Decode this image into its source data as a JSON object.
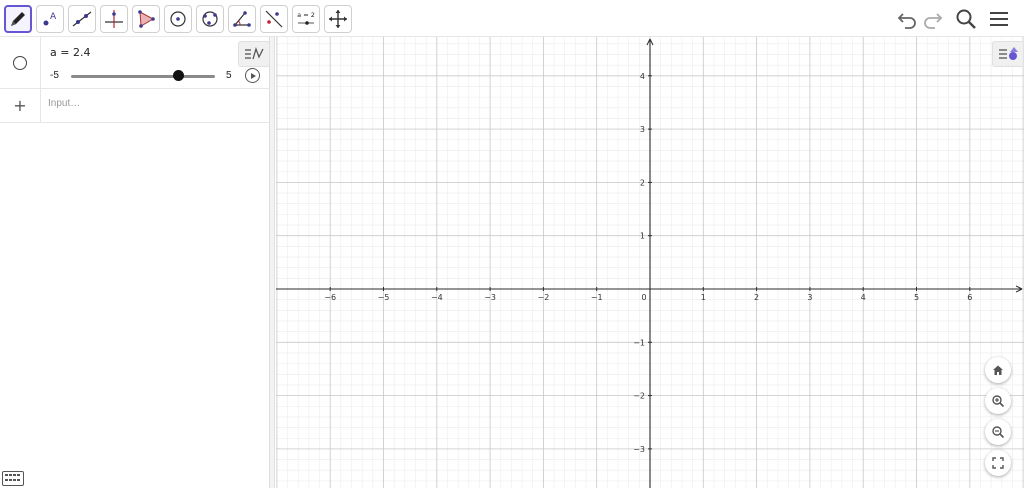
{
  "toolbar": {
    "tools": [
      {
        "name": "move-tool",
        "active": true
      },
      {
        "name": "point-tool"
      },
      {
        "name": "line-tool"
      },
      {
        "name": "perpendicular-line-tool"
      },
      {
        "name": "polygon-tool"
      },
      {
        "name": "circle-with-center-tool"
      },
      {
        "name": "circle-through-points-tool"
      },
      {
        "name": "angle-tool"
      },
      {
        "name": "reflect-tool"
      },
      {
        "name": "slider-tool",
        "label": "a = 2"
      },
      {
        "name": "move-graphics-view-tool"
      }
    ],
    "actions": [
      "undo-icon",
      "redo-icon",
      "search-icon",
      "menu-icon"
    ]
  },
  "algebra": {
    "slider": {
      "expression": "a = 2.4",
      "value": 2.4,
      "min": -5,
      "max": 5,
      "min_label": "-5",
      "max_label": "5"
    },
    "input": {
      "placeholder": "Input…",
      "value": ""
    }
  },
  "graphics": {
    "x_ticks": [
      "−6",
      "−5",
      "−4",
      "−3",
      "−2",
      "−1",
      "0",
      "1",
      "2",
      "3",
      "4",
      "5",
      "6"
    ],
    "y_ticks": [
      "4",
      "3",
      "2",
      "1",
      "−1",
      "−2",
      "−3"
    ],
    "view_controls": [
      "home-icon",
      "zoom-in-icon",
      "zoom-out-icon",
      "fullscreen-icon"
    ]
  },
  "colors": {
    "accent": "#6557d2",
    "axis": "#2b2b2b",
    "major_grid": "#c9c9c9",
    "minor_grid": "#ececec"
  }
}
